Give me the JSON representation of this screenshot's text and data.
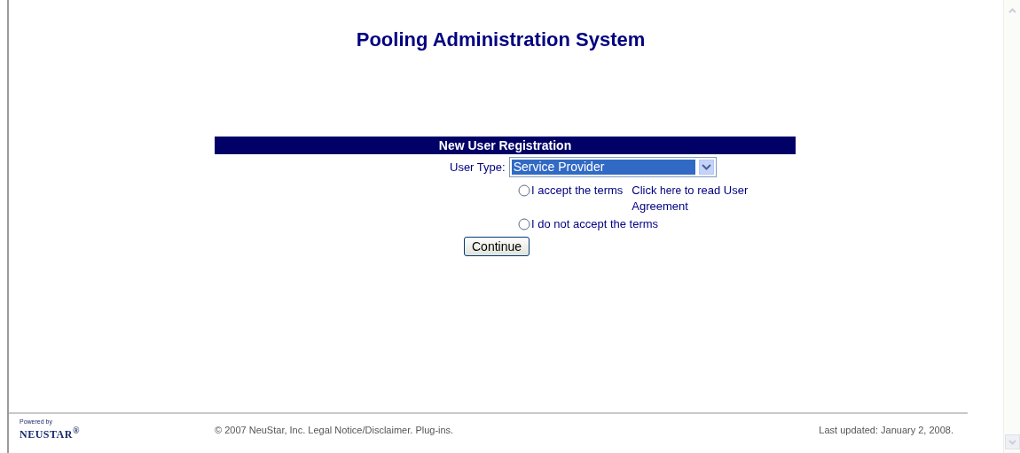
{
  "title": "Pooling Administration System",
  "form": {
    "heading": "New User Registration",
    "user_type": {
      "label": "User Type:",
      "value": "Service Provider"
    },
    "terms_options": [
      {
        "label": "I accept the terms",
        "selected": false
      },
      {
        "label": "I do not accept the terms",
        "selected": false
      }
    ],
    "agreement_note": {
      "before": "Click",
      "link": "here",
      "after": "to read User Agreement"
    },
    "continue_button": "Continue"
  },
  "footer": {
    "logo_caption": "Powered by",
    "logo": "NEUSTAR$^{®}$",
    "copyright": "© 2007 NeuStar, Inc. Legal Notice/Disclaimer. Plug-ins.",
    "last_updated": "Last updated: January 2, 2008."
  }
}
